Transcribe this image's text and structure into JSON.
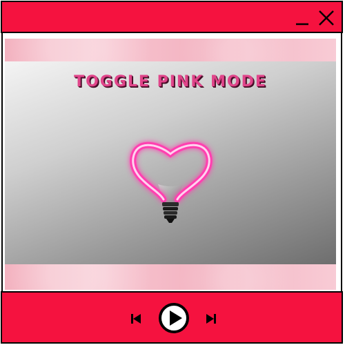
{
  "window": {
    "accent_color": "#f5123f",
    "controls": {
      "minimize_icon": "minimize-icon",
      "close_icon": "close-icon"
    }
  },
  "stage": {
    "title": "TOGGLE PINK MODE",
    "title_color": "#e0458a",
    "image_icon": "heart-light-bulb"
  },
  "player": {
    "previous_icon": "skip-previous-icon",
    "play_icon": "play-icon",
    "next_icon": "skip-next-icon"
  }
}
